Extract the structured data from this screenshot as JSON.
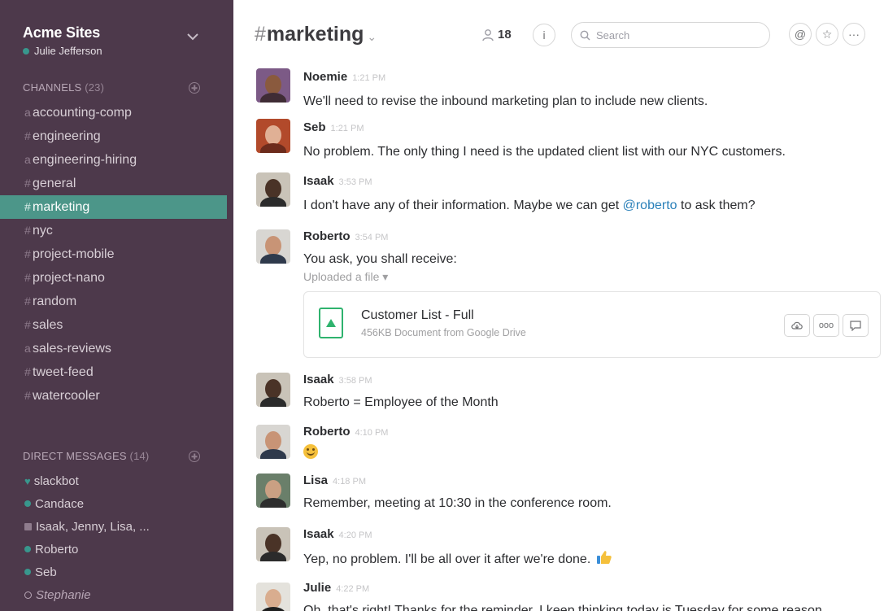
{
  "team": {
    "name": "Acme Sites",
    "user": "Julie Jefferson"
  },
  "sidebar": {
    "channels_label": "CHANNELS",
    "channels_count": "(23)",
    "channels": [
      {
        "name": "accounting-comp",
        "prefix": "lock"
      },
      {
        "name": "engineering",
        "prefix": "hash"
      },
      {
        "name": "engineering-hiring",
        "prefix": "lock"
      },
      {
        "name": "general",
        "prefix": "hash"
      },
      {
        "name": "marketing",
        "prefix": "hash",
        "active": true
      },
      {
        "name": "nyc",
        "prefix": "hash"
      },
      {
        "name": "project-mobile",
        "prefix": "hash"
      },
      {
        "name": "project-nano",
        "prefix": "hash"
      },
      {
        "name": "random",
        "prefix": "hash"
      },
      {
        "name": "sales",
        "prefix": "hash"
      },
      {
        "name": "sales-reviews",
        "prefix": "lock"
      },
      {
        "name": "tweet-feed",
        "prefix": "hash"
      },
      {
        "name": "watercooler",
        "prefix": "hash"
      }
    ],
    "dm_label": "DIRECT MESSAGES",
    "dm_count": "(14)",
    "dms": [
      {
        "name": "slackbot",
        "status": "heart"
      },
      {
        "name": "Candace",
        "status": "online"
      },
      {
        "name": "Isaak, Jenny, Lisa, ...",
        "status": "group"
      },
      {
        "name": "Roberto",
        "status": "online"
      },
      {
        "name": "Seb",
        "status": "online"
      },
      {
        "name": "Stephanie",
        "status": "away"
      }
    ]
  },
  "header": {
    "hash": "#",
    "channel": "marketing",
    "members": "18",
    "search_placeholder": "Search",
    "info_icon": "i",
    "at_icon": "@",
    "star_icon": "☆",
    "more_icon": "···"
  },
  "messages": [
    {
      "author": "Noemie",
      "time": "1:21 PM",
      "text": "We'll need to revise the inbound marketing plan to include new clients."
    },
    {
      "author": "Seb",
      "time": "1:21 PM",
      "text": "No problem. The only thing I need is the updated client list with our NYC customers."
    },
    {
      "author": "Isaak",
      "time": "3:53 PM",
      "text_before": "I don't have any of their information. Maybe we can get ",
      "mention": "@roberto",
      "text_after": " to ask them?"
    },
    {
      "author": "Roberto",
      "time": "3:54 PM",
      "text": "You ask, you shall receive:",
      "uploaded": "Uploaded a file ▾",
      "file": {
        "name": "Customer List - Full",
        "meta": "456KB Document from Google Drive"
      }
    },
    {
      "author": "Isaak",
      "time": "3:58 PM",
      "text": "Roberto = Employee of the Month"
    },
    {
      "author": "Roberto",
      "time": "4:10 PM",
      "emoji": "smile"
    },
    {
      "author": "Lisa",
      "time": "4:18 PM",
      "text": "Remember, meeting at 10:30 in the conference room."
    },
    {
      "author": "Isaak",
      "time": "4:20 PM",
      "text": "Yep, no problem. I'll be all over it after we're done.",
      "emoji": "thumbs-up"
    },
    {
      "author": "Julie",
      "time": "4:22 PM",
      "text": "Oh, that's right! Thanks for the reminder. I keep thinking today is Tuesday for some reason."
    }
  ],
  "colors": {
    "sidebar": "#4d394b",
    "active": "#4c9689",
    "online": "#38978d",
    "mention": "#2a80b9"
  }
}
